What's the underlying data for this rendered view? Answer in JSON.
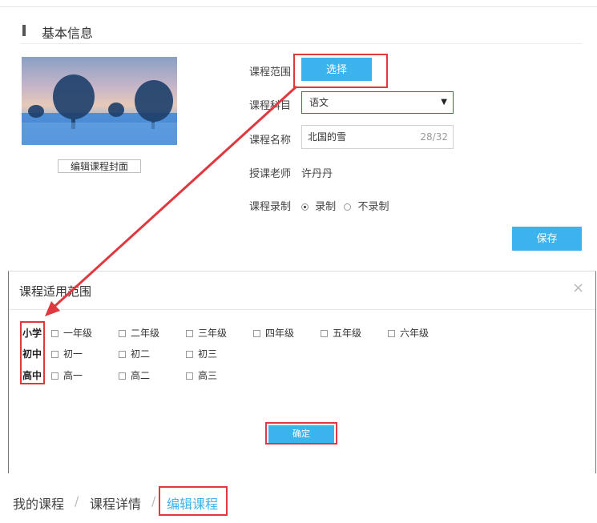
{
  "basic_info": {
    "section_title": "基本信息",
    "cover_button": "编辑课程封面",
    "fields": {
      "scope_label": "课程范围",
      "select_button": "选择",
      "subject_label": "课程科目",
      "subject_value": "语文",
      "name_label": "课程名称",
      "name_value": "北国的雪",
      "name_count": "28/32",
      "teacher_label": "授课老师",
      "teacher_value": "许丹丹",
      "record_label": "课程录制",
      "record_on": "录制",
      "record_off": "不录制"
    },
    "save_button": "保存"
  },
  "scope_dialog": {
    "title": "课程适用范围",
    "close": "×",
    "levels": [
      {
        "name": "小学",
        "grades": [
          "一年级",
          "二年级",
          "三年级",
          "四年级",
          "五年级",
          "六年级"
        ]
      },
      {
        "name": "初中",
        "grades": [
          "初一",
          "初二",
          "初三"
        ]
      },
      {
        "name": "高中",
        "grades": [
          "高一",
          "高二",
          "高三"
        ]
      }
    ],
    "confirm_button": "确定"
  },
  "breadcrumb": {
    "items": [
      "我的课程",
      "课程详情",
      "编辑课程"
    ],
    "separator": "/"
  },
  "colors": {
    "accent": "#3cb3ec",
    "highlight": "#e0383e"
  }
}
